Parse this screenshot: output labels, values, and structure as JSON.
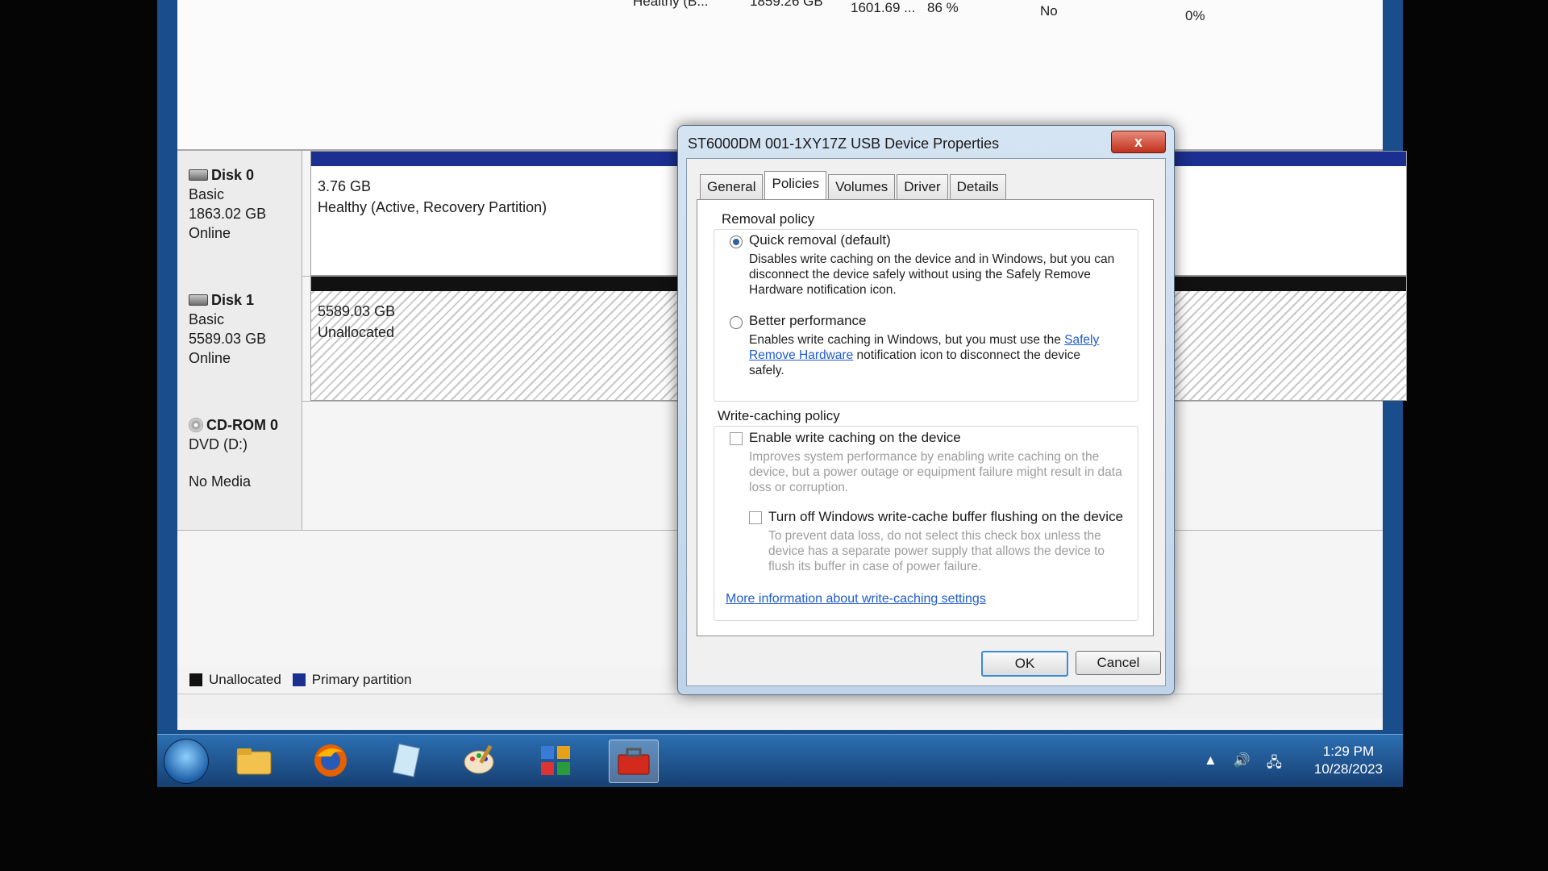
{
  "volume_row": {
    "status": "Healthy (B...",
    "capacity": "1859.26 GB",
    "free": "1601.69 ...",
    "percent": "86 %",
    "fault_tolerance": "No",
    "overhead": "0%"
  },
  "disks": [
    {
      "name": "Disk 0",
      "type": "Basic",
      "size": "1863.02 GB",
      "state": "Online",
      "partition_size": "3.76 GB",
      "partition_status": "Healthy (Active, Recovery Partition)"
    },
    {
      "name": "Disk 1",
      "type": "Basic",
      "size": "5589.03 GB",
      "state": "Online",
      "partition_size": "5589.03 GB",
      "partition_status": "Unallocated"
    },
    {
      "name": "CD-ROM 0",
      "type": "DVD (D:)",
      "size": "",
      "state": "No Media"
    }
  ],
  "legend": {
    "unallocated": "Unallocated",
    "primary": "Primary partition",
    "unallocated_color": "#111111",
    "primary_color": "#1a2f8f"
  },
  "dialog": {
    "title": "ST6000DM 001-1XY17Z USB Device Properties",
    "close_glyph": "x",
    "tabs": [
      "General",
      "Policies",
      "Volumes",
      "Driver",
      "Details"
    ],
    "active_tab": "Policies",
    "removal_policy": {
      "title": "Removal policy",
      "quick_label": "Quick removal (default)",
      "quick_selected": true,
      "quick_desc": "Disables write caching on the device and in Windows, but you can disconnect the device safely without using the Safely Remove Hardware notification icon.",
      "better_label": "Better performance",
      "better_selected": false,
      "better_desc_1": "Enables write caching in Windows, but you must use the",
      "better_link": "Safely Remove Hardware",
      "better_desc_2": "notification icon to disconnect the device safely."
    },
    "write_caching": {
      "title": "Write-caching policy",
      "enable_label": "Enable write caching on the device",
      "enable_desc": "Improves system performance by enabling write caching on the device, but a power outage or equipment failure might result in data loss or corruption.",
      "turnoff_label": "Turn off Windows write-cache buffer flushing on the device",
      "turnoff_desc": "To prevent data loss, do not select this check box unless the device has a separate power supply that allows the device to flush its buffer in case of power failure.",
      "more_info_link": "More information about write-caching settings"
    },
    "ok_label": "OK",
    "cancel_label": "Cancel"
  },
  "taskbar": {
    "icons": [
      "start-orb",
      "folder-icon",
      "firefox-icon",
      "notepad-icon",
      "paint-icon",
      "control-panel-icon",
      "toolbox-icon"
    ],
    "time": "1:29 PM",
    "date": "10/28/2023"
  }
}
